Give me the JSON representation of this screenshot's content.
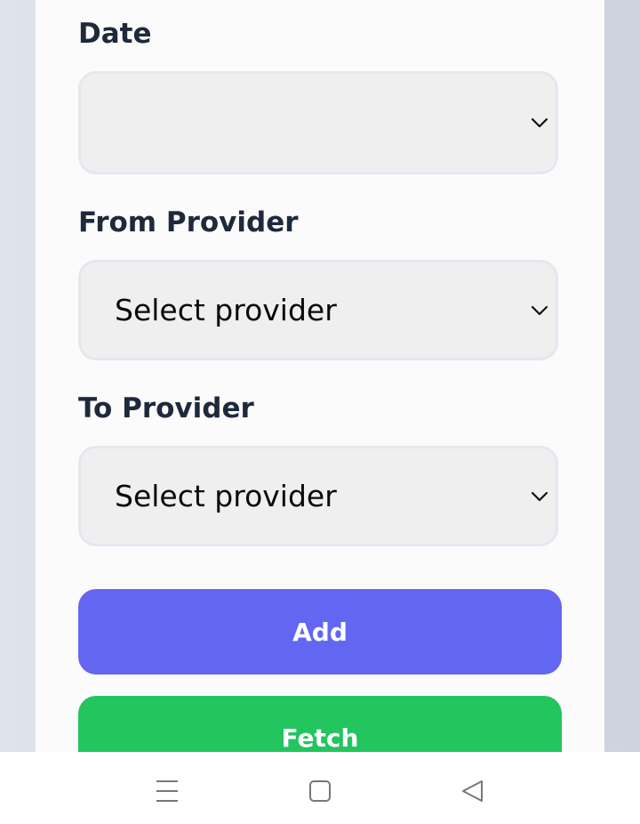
{
  "form": {
    "date": {
      "label": "Date",
      "value": ""
    },
    "from_provider": {
      "label": "From Provider",
      "value": "Select provider"
    },
    "to_provider": {
      "label": "To Provider",
      "value": "Select provider"
    },
    "add_label": "Add",
    "fetch_label": "Fetch"
  },
  "nav": {
    "icons": [
      "menu-icon",
      "home-square-icon",
      "back-triangle-icon"
    ]
  },
  "colors": {
    "add_button": "#6366f1",
    "fetch_button": "#22c55e",
    "label_text": "#1e293b",
    "select_bg": "#efefef"
  }
}
